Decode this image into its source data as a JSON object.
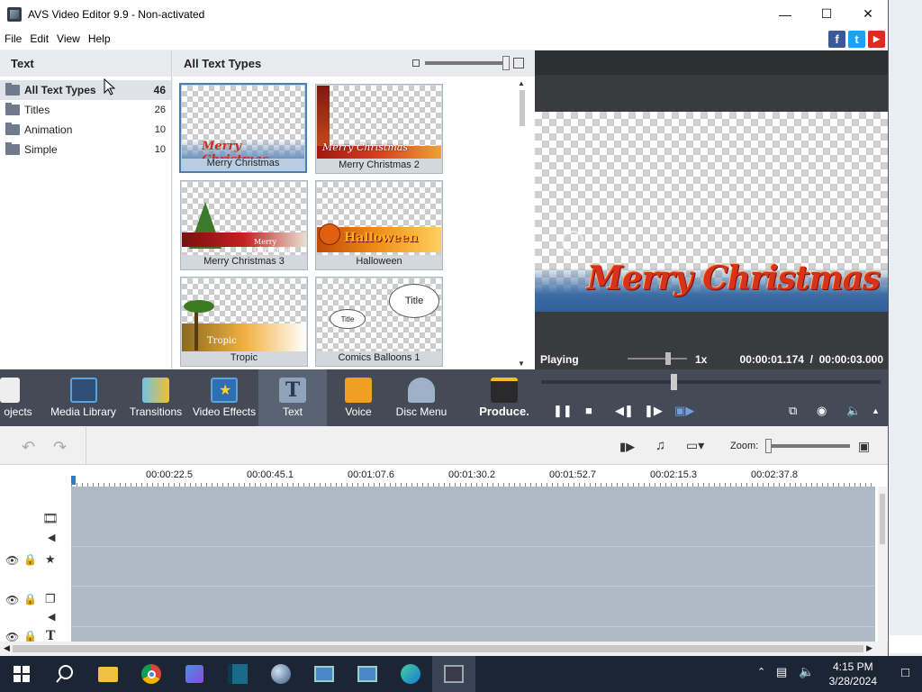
{
  "window": {
    "title": "AVS Video Editor 9.9 - Non-activated"
  },
  "menu": {
    "file": "File",
    "edit": "Edit",
    "view": "View",
    "help": "Help"
  },
  "social": {
    "facebook": "f",
    "twitter": "t",
    "youtube": "▶"
  },
  "tree": {
    "header": "Text",
    "items": [
      {
        "label": "All Text Types",
        "count": "46"
      },
      {
        "label": "Titles",
        "count": "26"
      },
      {
        "label": "Animation",
        "count": "10"
      },
      {
        "label": "Simple",
        "count": "10"
      }
    ]
  },
  "thumbs": {
    "header": "All Text Types",
    "items": [
      {
        "caption": "Merry Christmas",
        "overlay": "Merry Christmas"
      },
      {
        "caption": "Merry Christmas 2",
        "overlay": "Merry Christmas"
      },
      {
        "caption": "Merry Christmas 3",
        "overlay": "Merry Christmas"
      },
      {
        "caption": "Halloween",
        "overlay": "Halloween"
      },
      {
        "caption": "Tropic",
        "overlay": "Tropic"
      },
      {
        "caption": "Comics Balloons 1",
        "overlay": "Title",
        "overlay2": "Title"
      }
    ]
  },
  "preview": {
    "overlay_text": "Merry Christmas",
    "status": "Playing",
    "speed": "1x",
    "time": "00:00:01.174  /  00:00:03.000"
  },
  "toolbar": {
    "projects": "ojects",
    "media_library": "Media Library",
    "transitions": "Transitions",
    "video_effects": "Video Effects",
    "text": "Text",
    "voice": "Voice",
    "disc_menu": "Disc Menu",
    "produce": "Produce."
  },
  "timeline": {
    "zoom_label": "Zoom:",
    "ticks": [
      "00:00:22.5",
      "00:00:45.1",
      "00:01:07.6",
      "00:01:30.2",
      "00:01:52.7",
      "00:02:15.3",
      "00:02:37.8"
    ]
  },
  "taskbar": {
    "time": "4:15 PM",
    "date": "3/28/2024"
  },
  "colors": {
    "accent": "#4a7fb4",
    "toolbar": "#444b57",
    "timeline_track": "#b0bac6"
  }
}
